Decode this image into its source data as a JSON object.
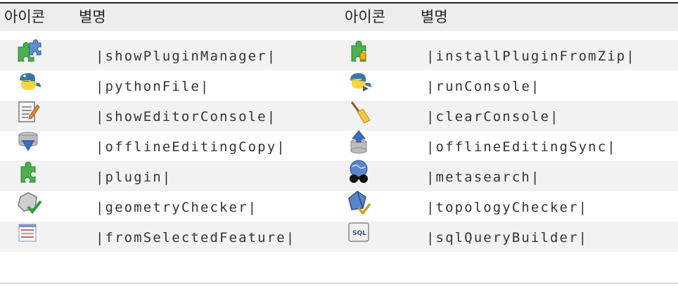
{
  "headers": [
    "아이콘",
    "별명",
    "아이콘",
    "별명"
  ],
  "rows": [
    {
      "left": {
        "icon": "plugin-manager-icon",
        "alias": "|showPluginManager|"
      },
      "right": {
        "icon": "install-plugin-zip-icon",
        "alias": "|installPluginFromZip|"
      }
    },
    {
      "left": {
        "icon": "python-file-icon",
        "alias": "|pythonFile|"
      },
      "right": {
        "icon": "python-run-console-icon",
        "alias": "|runConsole|"
      }
    },
    {
      "left": {
        "icon": "editor-console-icon",
        "alias": "|showEditorConsole|"
      },
      "right": {
        "icon": "broom-clear-icon",
        "alias": "|clearConsole|"
      }
    },
    {
      "left": {
        "icon": "offline-editing-copy-icon",
        "alias": "|offlineEditingCopy|"
      },
      "right": {
        "icon": "offline-editing-sync-icon",
        "alias": "|offlineEditingSync|"
      }
    },
    {
      "left": {
        "icon": "plugin-icon",
        "alias": "|plugin|"
      },
      "right": {
        "icon": "metasearch-icon",
        "alias": "|metasearch|"
      }
    },
    {
      "left": {
        "icon": "geometry-checker-icon",
        "alias": "|geometryChecker|"
      },
      "right": {
        "icon": "topology-checker-icon",
        "alias": "|topologyChecker|"
      }
    },
    {
      "left": {
        "icon": "from-selected-feature-icon",
        "alias": "|fromSelectedFeature|"
      },
      "right": {
        "icon": "sql-query-builder-icon",
        "alias": "|sqlQueryBuilder|"
      }
    }
  ]
}
